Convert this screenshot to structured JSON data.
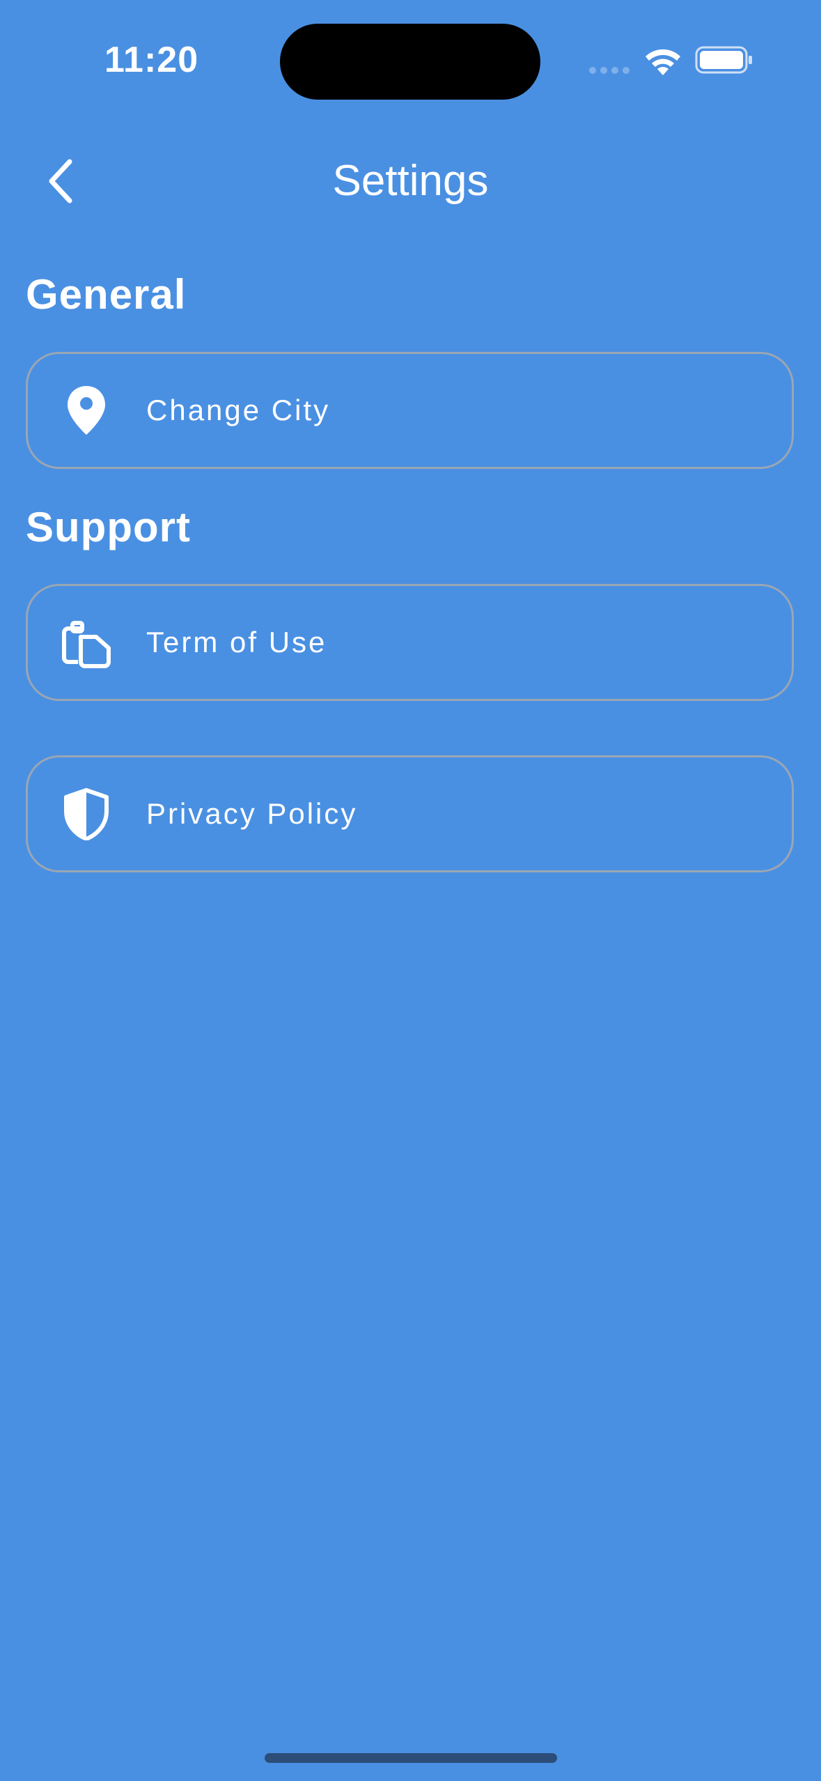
{
  "status_bar": {
    "time": "11:20"
  },
  "nav": {
    "title": "Settings",
    "back_icon": "chevron-left-icon"
  },
  "sections": {
    "general": {
      "title": "General",
      "items": [
        {
          "label": "Change City",
          "icon": "location-pin-icon"
        }
      ]
    },
    "support": {
      "title": "Support",
      "items": [
        {
          "label": "Term of Use",
          "icon": "clipboard-copy-icon"
        },
        {
          "label": "Privacy Policy",
          "icon": "shield-icon"
        }
      ]
    }
  },
  "colors": {
    "background": "#4a90e2",
    "row_border": "#9aa6b4",
    "text": "#ffffff"
  }
}
